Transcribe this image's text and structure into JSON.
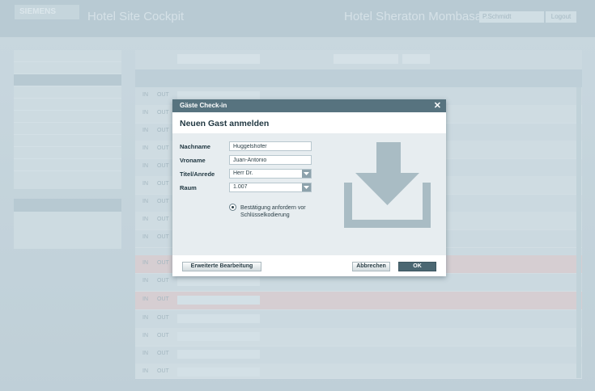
{
  "app": {
    "brand": "SIEMENS",
    "title": "Hotel Site Cockpit",
    "hotel": "Hotel Sheraton Mombasa",
    "user": "P.Schmidt",
    "logout": "Logout"
  },
  "dialog": {
    "title": "Gäste Check-in",
    "close": "✕",
    "header": "Neuen Gast anmelden",
    "fields": {
      "nachname": {
        "label": "Nachname",
        "value": "Huggelshofer"
      },
      "vorname": {
        "label": "Vroname",
        "value": "Juan-Antonio"
      },
      "titel": {
        "label": "Titel/Anrede",
        "value": "Herr Dr."
      },
      "raum": {
        "label": "Raum",
        "value": "1.007"
      }
    },
    "confirm_label": "Bestätigung anfordern vor Schlüsselkodierung",
    "buttons": {
      "extended": "Erweiterte Bearbeitung",
      "cancel": "Abbrechen",
      "ok": "OK"
    }
  },
  "grid": {
    "in_label": "IN",
    "out_label": "OUT"
  },
  "colors": {
    "title_bar": "#57737f",
    "ok_button": "#4b6772",
    "download_icon": "#a9bcc4"
  }
}
